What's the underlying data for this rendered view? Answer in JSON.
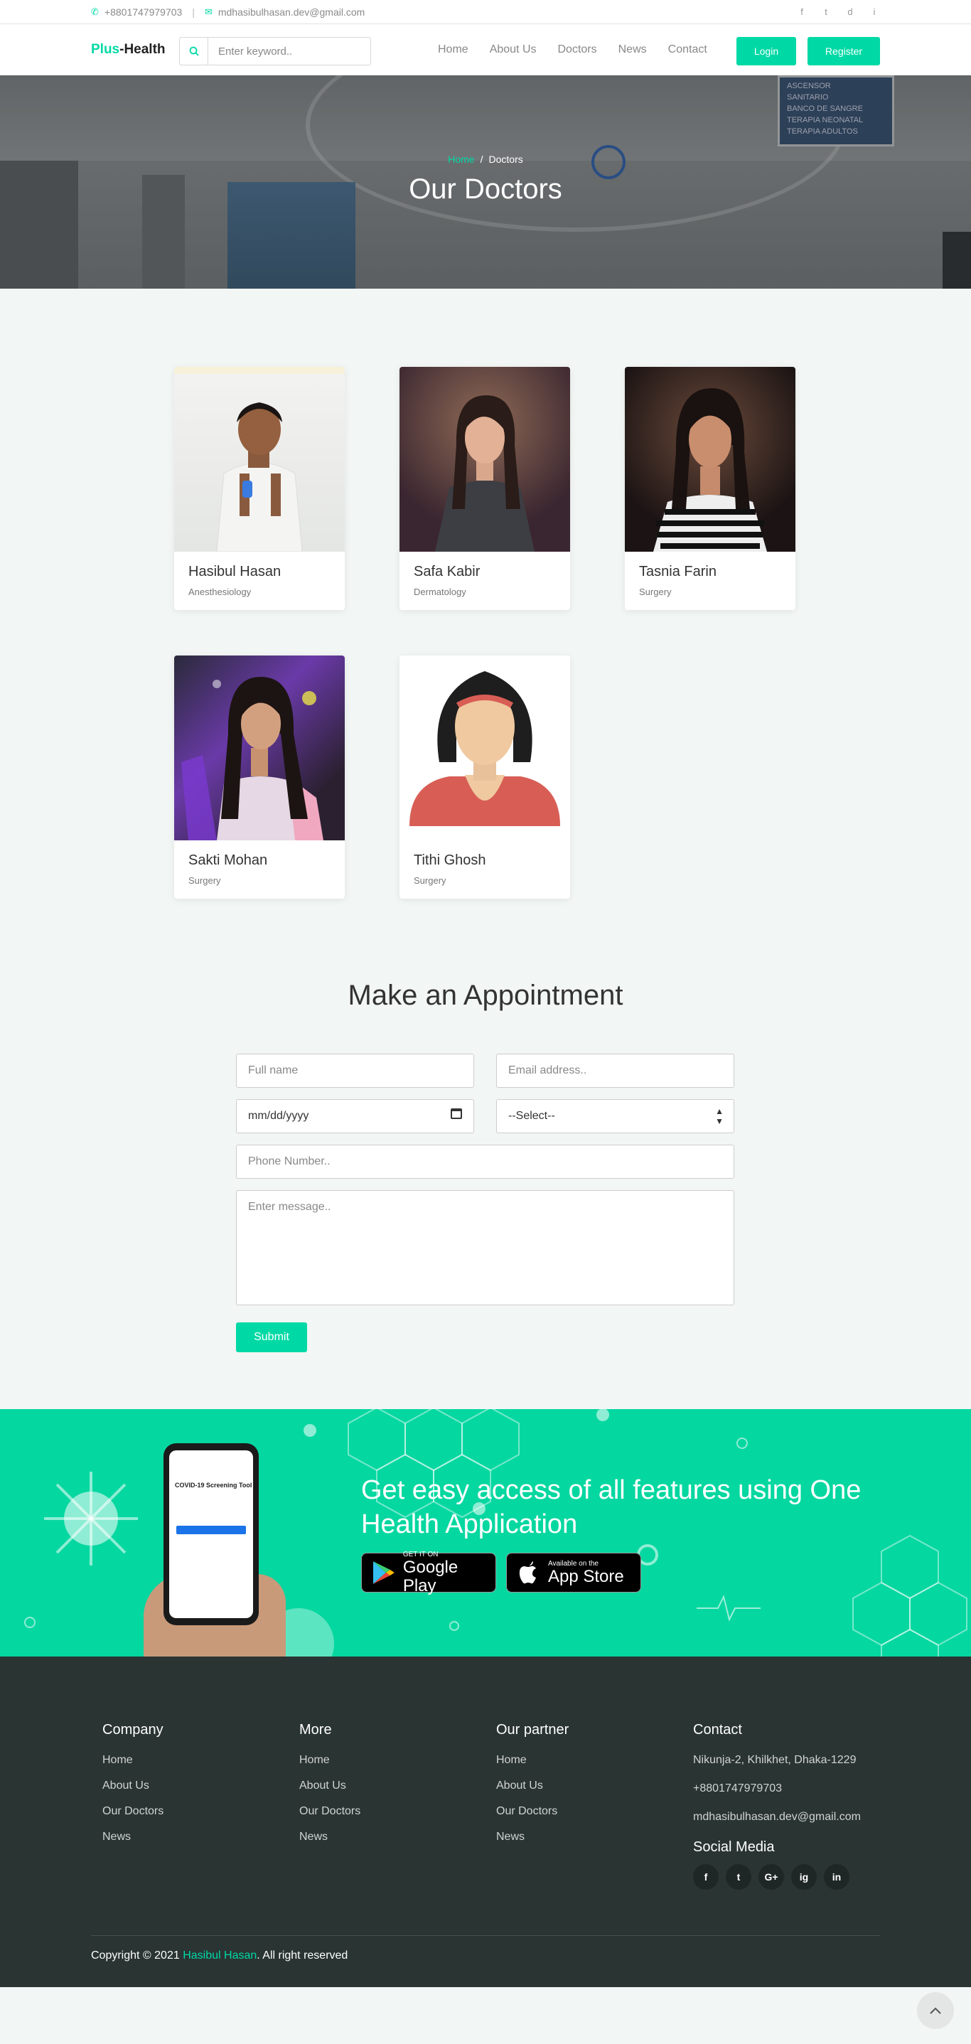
{
  "topbar": {
    "phone": "+8801747979703",
    "email": "mdhasibulhasan.dev@gmail.com",
    "social": [
      "f",
      "t",
      "d",
      "i"
    ]
  },
  "navbar": {
    "brand_part1": "Plus",
    "brand_part2": "-Health",
    "search_placeholder": "Enter keyword..",
    "links": [
      "Home",
      "About Us",
      "Doctors",
      "News",
      "Contact"
    ],
    "login": "Login",
    "register": "Register"
  },
  "hero": {
    "breadcrumb_home": "Home",
    "breadcrumb_sep": "/",
    "breadcrumb_current": "Doctors",
    "title": "Our Doctors",
    "sign_lines": [
      "ASCENSOR",
      "SANITARIO",
      "BANCO DE SANGRE",
      "TERAPIA NEONATAL",
      "TERAPIA ADULTOS"
    ]
  },
  "doctors": [
    {
      "name": "Hasibul Hasan",
      "specialty": "Anesthesiology"
    },
    {
      "name": "Safa Kabir",
      "specialty": "Dermatology"
    },
    {
      "name": "Tasnia Farin",
      "specialty": "Surgery"
    },
    {
      "name": "Sakti Mohan",
      "specialty": "Surgery"
    },
    {
      "name": "Tithi Ghosh",
      "specialty": "Surgery"
    }
  ],
  "appointment": {
    "title": "Make an Appointment",
    "full_name_placeholder": "Full name",
    "email_placeholder": "Email address..",
    "date_placeholder": "mm/dd/yyyy",
    "select_value": "--Select--",
    "phone_placeholder": "Phone Number..",
    "message_placeholder": "Enter message..",
    "submit": "Submit"
  },
  "app_banner": {
    "headline": "Get easy access of all features using One Health Application",
    "phone_screen_title": "COVID-19 Screening Tool",
    "google_small": "GET IT ON",
    "google_large": "Google Play",
    "apple_small": "Available on the",
    "apple_large": "App Store"
  },
  "footer": {
    "columns": [
      {
        "title": "Company",
        "links": [
          "Home",
          "About Us",
          "Our Doctors",
          "News"
        ]
      },
      {
        "title": "More",
        "links": [
          "Home",
          "About Us",
          "Our Doctors",
          "News"
        ]
      },
      {
        "title": "Our partner",
        "links": [
          "Home",
          "About Us",
          "Our Doctors",
          "News"
        ]
      }
    ],
    "contact": {
      "title": "Contact",
      "address": "Nikunja-2, Khilkhet, Dhaka-1229",
      "phone": "+8801747979703",
      "email": "mdhasibulhasan.dev@gmail.com"
    },
    "social_title": "Social Media",
    "social_icons": [
      "f",
      "t",
      "G+",
      "ig",
      "in"
    ],
    "copyright_prefix": "Copyright © 2021 ",
    "copyright_name": "Hasibul Hasan",
    "copyright_suffix": ". All right reserved"
  },
  "colors": {
    "accent": "#00d9a5",
    "footer_bg": "#2a3433",
    "page_bg": "#f2f6f4"
  }
}
